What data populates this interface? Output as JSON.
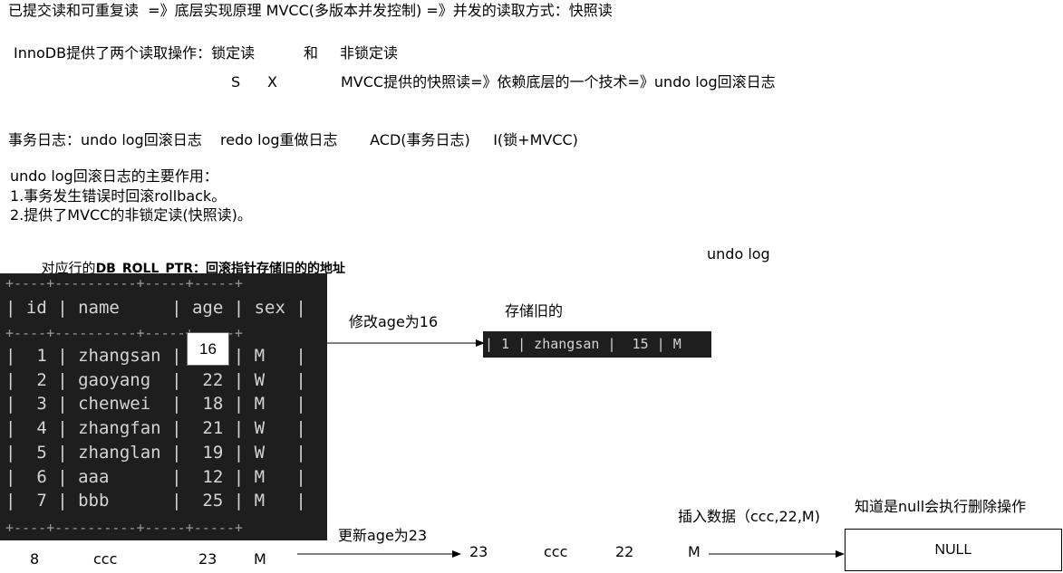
{
  "notes": {
    "line1": "已提交读和可重复读  =》底层实现原理 MVCC(多版本并发控制) =》并发的读取方式：快照读",
    "innodb_prefix": "InnoDB提供了两个读取操作：锁定读",
    "innodb_and": "和",
    "innodb_nonlock": "非锁定读",
    "lock_s": "S",
    "lock_x": "X",
    "mvcc_snapshot": "MVCC提供的快照读=》依赖底层的一个技术=》undo log回滚日志",
    "logs_line": "事务日志：undo log回滚日志    redo log重做日志       ACD(事务日志)     I(锁+MVCC)",
    "undo_title": "undo log回滚日志的主要作用：",
    "undo_item1": "1.事务发生错误时回滚rollback。",
    "undo_item2": "2.提供了MVCC的非锁定读(快照读)。",
    "roll_ptr_prefix": "对应行的",
    "roll_ptr_bold": "DB_ROLL_PTR：回滚指针存储旧的的地址",
    "undo_log_label": "undo log"
  },
  "table": {
    "columns": [
      "id",
      "name",
      "age",
      "sex"
    ],
    "rows": [
      [
        "1",
        "zhangsan",
        "15",
        "M"
      ],
      [
        "2",
        "gaoyang",
        "22",
        "W"
      ],
      [
        "3",
        "chenwei",
        "18",
        "M"
      ],
      [
        "4",
        "zhangfan",
        "21",
        "W"
      ],
      [
        "5",
        "zhanglan",
        "19",
        "W"
      ],
      [
        "6",
        "aaa",
        "12",
        "M"
      ],
      [
        "7",
        "bbb",
        "25",
        "M"
      ]
    ],
    "overlay_value": "16"
  },
  "update_arrow": {
    "label": "修改age为16",
    "stored_old_label": "存储旧的",
    "old_row": "| 1 | zhangsan |  15 | M"
  },
  "new_row": {
    "id": "8",
    "name": "ccc",
    "age": "23",
    "sex": "M"
  },
  "update_age_arrow": {
    "label": "更新age为23",
    "result_age": "23",
    "result_name": "ccc",
    "result_old_age": "22",
    "result_sex": "M"
  },
  "insert": {
    "label": "插入数据（ccc,22,M)",
    "null_note": "知道是null会执行删除操作",
    "null_value": "NULL"
  }
}
